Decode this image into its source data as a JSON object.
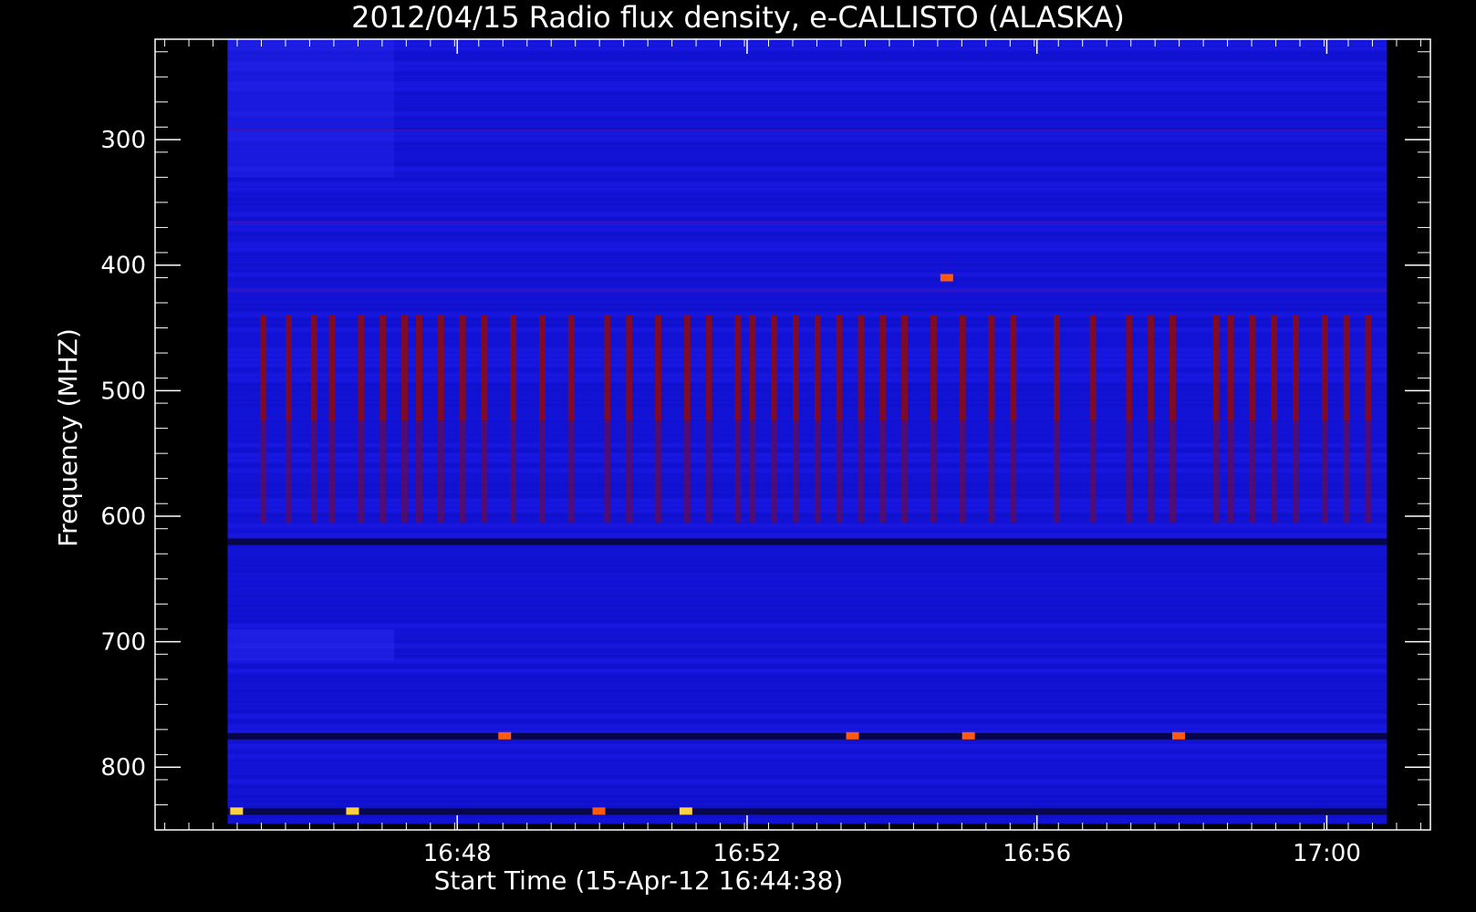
{
  "chart_data": {
    "type": "heatmap",
    "title": "2012/04/15  Radio flux density, e-CALLISTO (ALASKA)",
    "xlabel": "Start Time (15-Apr-12 16:44:38)",
    "ylabel": "Frequency (MHZ)",
    "x_unit": "minutes after 16:44:38",
    "xlim": [
      -0.8,
      16.8
    ],
    "data_xlim": [
      0.2,
      16.2
    ],
    "ylim": [
      850,
      220
    ],
    "data_ylim": [
      845,
      220
    ],
    "y_inverted": true,
    "x_ticks": [
      {
        "value": 3.37,
        "label": "16:48"
      },
      {
        "value": 7.37,
        "label": "16:52"
      },
      {
        "value": 11.37,
        "label": "16:56"
      },
      {
        "value": 15.37,
        "label": "17:00"
      }
    ],
    "y_ticks": [
      {
        "value": 300,
        "label": "300"
      },
      {
        "value": 400,
        "label": "400"
      },
      {
        "value": 500,
        "label": "500"
      },
      {
        "value": 600,
        "label": "600"
      },
      {
        "value": 700,
        "label": "700"
      },
      {
        "value": 800,
        "label": "800"
      }
    ],
    "colormap": [
      "#000000",
      "#1010e0",
      "#8b0a12",
      "#ff4000",
      "#ffff60"
    ],
    "background_level": "blue",
    "interference_band_mhz": [
      440,
      605
    ],
    "interference_stripe_times": [
      0.65,
      1.0,
      1.35,
      1.6,
      2.0,
      2.3,
      2.6,
      2.8,
      3.1,
      3.4,
      3.7,
      4.1,
      4.5,
      4.9,
      5.4,
      5.7,
      6.1,
      6.5,
      6.8,
      7.2,
      7.4,
      7.7,
      8.0,
      8.3,
      8.6,
      8.9,
      9.2,
      9.5,
      9.9,
      10.3,
      10.7,
      11.0,
      11.6,
      12.1,
      12.6,
      12.9,
      13.2,
      13.8,
      14.0,
      14.3,
      14.6,
      14.9,
      15.3,
      15.6,
      15.9
    ],
    "dark_bands_mhz": [
      620,
      775,
      835
    ],
    "hot_spots": [
      {
        "t": 0.3,
        "f": 835,
        "level": "yellow"
      },
      {
        "t": 1.9,
        "f": 835,
        "level": "yellow"
      },
      {
        "t": 4.0,
        "f": 775,
        "level": "orange"
      },
      {
        "t": 5.3,
        "f": 835,
        "level": "orange"
      },
      {
        "t": 6.5,
        "f": 835,
        "level": "yellow"
      },
      {
        "t": 8.8,
        "f": 775,
        "level": "orange"
      },
      {
        "t": 10.1,
        "f": 410,
        "level": "orange"
      },
      {
        "t": 10.4,
        "f": 775,
        "level": "orange"
      },
      {
        "t": 13.3,
        "f": 775,
        "level": "orange"
      }
    ]
  }
}
